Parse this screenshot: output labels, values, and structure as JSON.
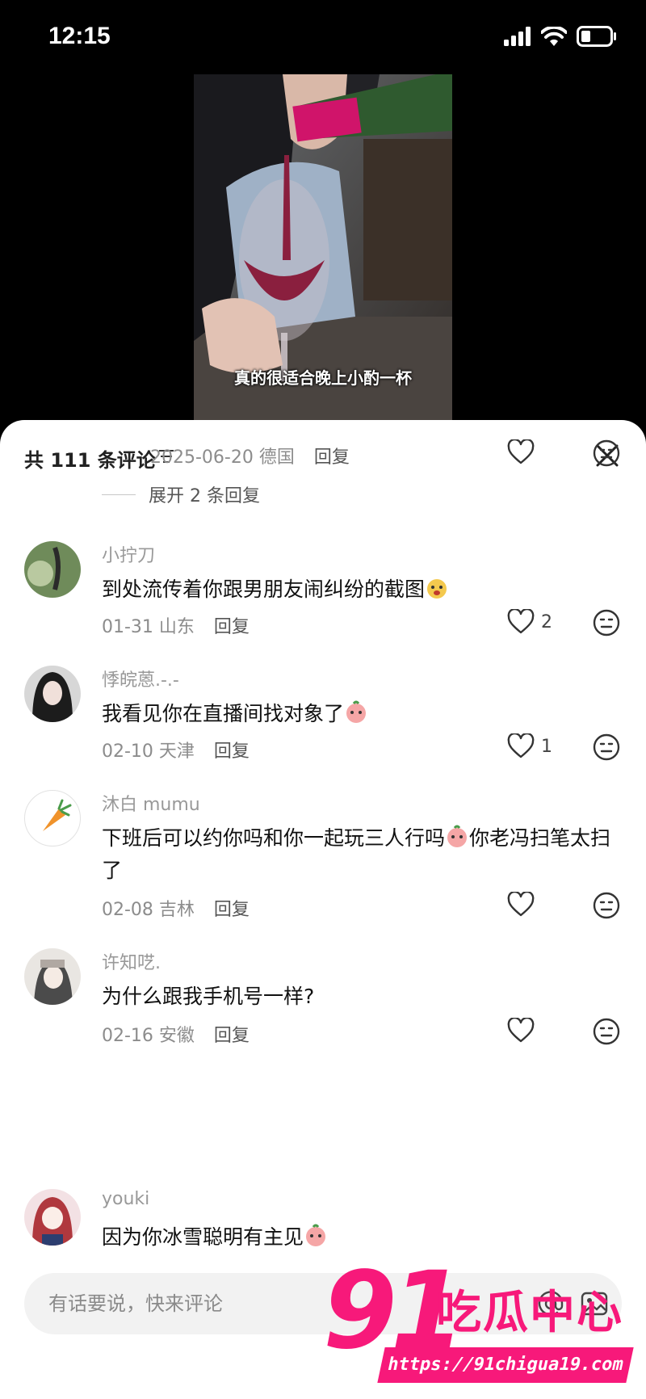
{
  "status": {
    "time": "12:15"
  },
  "video": {
    "caption": "真的很适合晚上小酌一杯"
  },
  "comments_panel": {
    "title": "共 111 条评论",
    "first_partial": {
      "date_location": "2025-06-20 德国",
      "reply": "回复"
    },
    "expand_replies": "展开 2 条回复",
    "comments": [
      {
        "username": "小拧刀",
        "text": "到处流传着你跟男朋友闹纠纷的截图",
        "date_location": "01-31 山东",
        "reply": "回复",
        "likes": "2"
      },
      {
        "username": "悸皖蒽.-.-",
        "text": "我看见你在直播间找对象了",
        "date_location": "02-10 天津",
        "reply": "回复",
        "likes": "1"
      },
      {
        "username": "沐白 mumu",
        "text_a": "下班后可以约你吗和你一起玩三人行吗",
        "text_b": "你老冯扫笔太扫了",
        "date_location": "02-08 吉林",
        "reply": "回复",
        "likes": ""
      },
      {
        "username": "许知呓.",
        "text": "为什么跟我手机号一样?",
        "date_location": "02-16 安徽",
        "reply": "回复",
        "likes": ""
      },
      {
        "username": "youki",
        "text": "因为你冰雪聪明有主见"
      }
    ]
  },
  "input": {
    "placeholder": "有话要说，快来评论"
  },
  "watermark": {
    "number": "91",
    "text": "吃瓜中心",
    "url": "https://91chigua19.com"
  },
  "colors": {
    "accent": "#f7197a",
    "muted": "#8c8c8c"
  },
  "icons": [
    "signal-icon",
    "wifi-icon",
    "battery-icon",
    "filter-icon",
    "close-icon",
    "heart-icon",
    "dislike-face-icon",
    "at-icon",
    "image-icon"
  ]
}
